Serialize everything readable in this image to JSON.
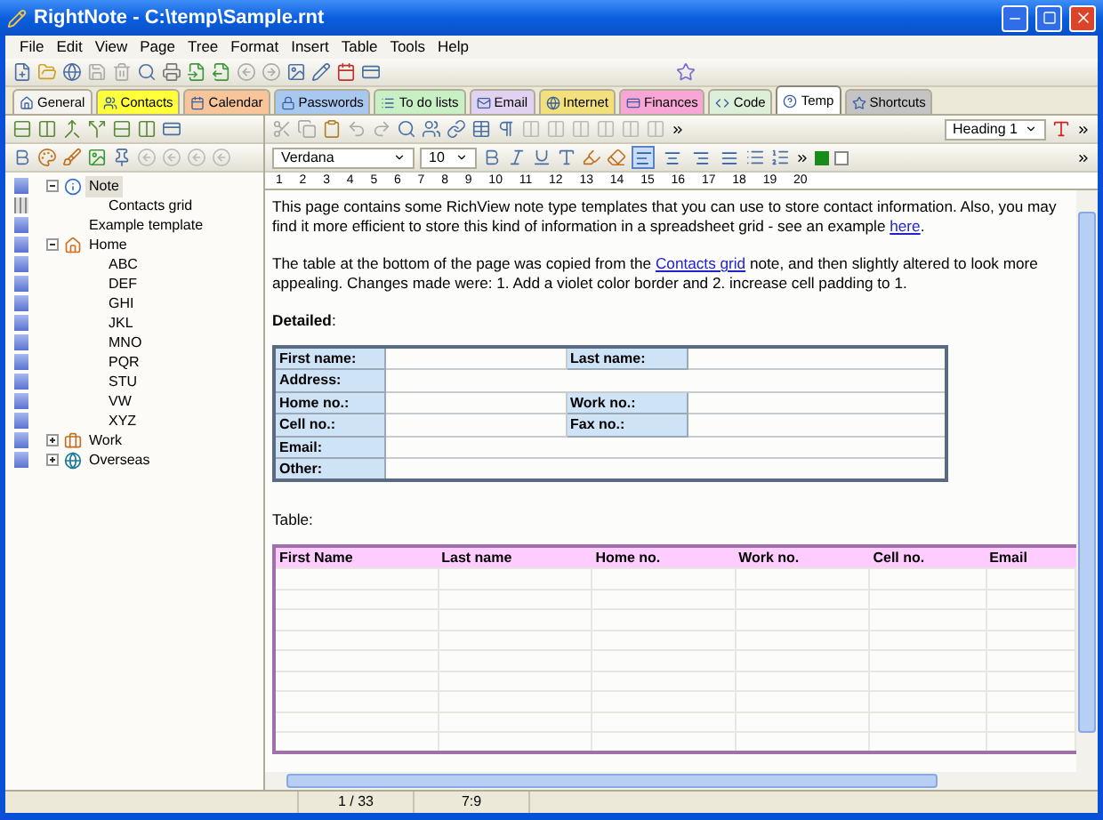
{
  "window": {
    "title": "RightNote - C:\\temp\\Sample.rnt"
  },
  "menu": [
    "File",
    "Edit",
    "View",
    "Page",
    "Tree",
    "Format",
    "Insert",
    "Table",
    "Tools",
    "Help"
  ],
  "tabs": [
    {
      "label": "General",
      "color": "#f4f3ee",
      "selected": false
    },
    {
      "label": "Contacts",
      "color": "#ffff3c",
      "selected": false
    },
    {
      "label": "Calendar",
      "color": "#f8c59a",
      "selected": false
    },
    {
      "label": "Passwords",
      "color": "#a8c8f0",
      "selected": false
    },
    {
      "label": "To do lists",
      "color": "#c8f0c4",
      "selected": false
    },
    {
      "label": "Email",
      "color": "#e2d2f2",
      "selected": false
    },
    {
      "label": "Internet",
      "color": "#f2e07c",
      "selected": false
    },
    {
      "label": "Finances",
      "color": "#f7a6d6",
      "selected": false
    },
    {
      "label": "Code",
      "color": "#ddefd8",
      "selected": false
    },
    {
      "label": "Temp",
      "color": "#ffffff",
      "selected": true
    },
    {
      "label": "Shortcuts",
      "color": "#c4c4c4",
      "selected": false
    }
  ],
  "editor_toolbar": {
    "font": "Verdana",
    "size": "10",
    "style": "Heading 1",
    "align_buttons": [
      {
        "selected": true
      },
      {
        "selected": false
      },
      {
        "selected": false
      },
      {
        "selected": false
      }
    ]
  },
  "ruler": [
    "1",
    "2",
    "3",
    "4",
    "5",
    "6",
    "7",
    "8",
    "9",
    "10",
    "11",
    "12",
    "13",
    "14",
    "15",
    "16",
    "17",
    "18",
    "19",
    "20"
  ],
  "tree": [
    {
      "label": "Note",
      "kind": "info",
      "selected": true,
      "expanded": true,
      "children": [
        {
          "label": "Contacts grid",
          "kind": "grid",
          "selected": false
        }
      ]
    },
    {
      "label": "Example template",
      "kind": "plain",
      "selected": false
    },
    {
      "label": "Home",
      "kind": "home",
      "selected": false,
      "expanded": true,
      "children": [
        {
          "label": "ABC",
          "kind": "plain",
          "selected": false
        },
        {
          "label": "DEF",
          "kind": "plain",
          "selected": false
        },
        {
          "label": "GHI",
          "kind": "plain",
          "selected": false
        },
        {
          "label": "JKL",
          "kind": "plain",
          "selected": false
        },
        {
          "label": "MNO",
          "kind": "plain",
          "selected": false
        },
        {
          "label": "PQR",
          "kind": "plain",
          "selected": false
        },
        {
          "label": "STU",
          "kind": "plain",
          "selected": false
        },
        {
          "label": "VW",
          "kind": "plain",
          "selected": false
        },
        {
          "label": "XYZ",
          "kind": "plain",
          "selected": false
        }
      ]
    },
    {
      "label": "Work",
      "kind": "briefcase",
      "selected": false,
      "expanded": false
    },
    {
      "label": "Overseas",
      "kind": "globe",
      "selected": false,
      "expanded": false
    }
  ],
  "document": {
    "paragraphs": [
      {
        "before": "This page contains some RichView note type templates that you can use to store contact information. Also, you may find it more efficient to store this kind of information in a spreadsheet grid - see an example ",
        "link": "here",
        "after": "."
      },
      {
        "before": "The table at the bottom of the page was copied from the ",
        "link": "Contacts grid",
        "after": " note, and then slightly altered to look more appealing. Changes made were: 1. Add a violet color border and 2. increase cell padding to 1."
      }
    ],
    "detailed_heading": "**Detailed**:",
    "detailed_rows": [
      {
        "label": "First name:",
        "label_2": "Last name:"
      },
      {
        "label": "Address:"
      },
      {
        "label": "Home no.:",
        "label_2": "Work no.:"
      },
      {
        "label": "Cell no.:",
        "label_2": "Fax no.:"
      },
      {
        "label": "Email:"
      },
      {
        "label": "Other:"
      }
    ],
    "table_heading": "Table:",
    "table_columns": [
      "First Name",
      "Last name",
      "Home no.",
      "Work no.",
      "Cell no.",
      "Email"
    ]
  },
  "status_bar": {
    "page": "1 / 33",
    "position": "7:9"
  }
}
